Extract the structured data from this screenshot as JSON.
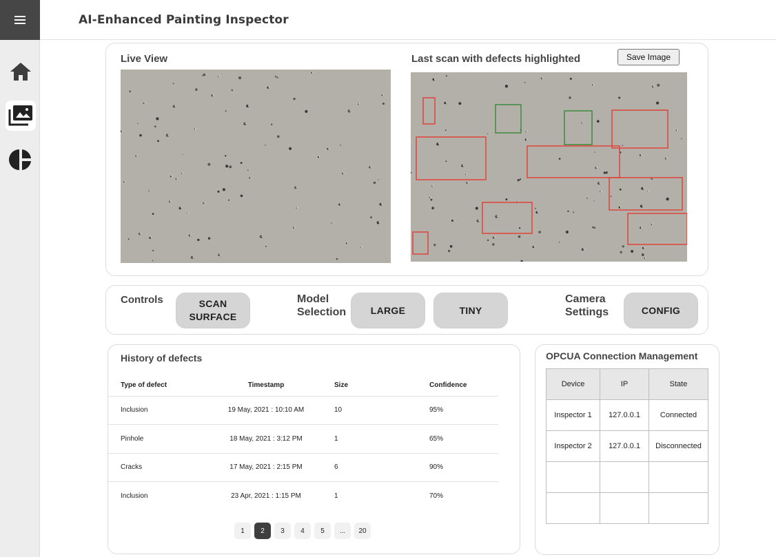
{
  "app": {
    "title": "AI-Enhanced Painting Inspector"
  },
  "sidebar": {
    "icons": [
      "menu-icon",
      "home-icon",
      "photo-library-icon",
      "pie-chart-icon"
    ],
    "active": "photo-library-icon"
  },
  "views": {
    "live_label": "Live View",
    "scan_label": "Last scan with defects highlighted",
    "save_button": "Save Image",
    "box_colors": {
      "defect": "#e0423a",
      "ok": "#3b8a3b"
    }
  },
  "controls": {
    "label": "Controls",
    "scan_button": "SCAN SURFACE",
    "model_label": "Model Selection",
    "large_button": "LARGE",
    "tiny_button": "TINY",
    "camera_label": "Camera Settings",
    "config_button": "CONFIG"
  },
  "history": {
    "title": "History of defects",
    "columns": [
      "Type of defect",
      "Timestamp",
      "Size",
      "Confidence"
    ],
    "rows": [
      {
        "type": "Inclusion",
        "timestamp": "19 May, 2021 : 10:10 AM",
        "size": "10",
        "confidence": "95%"
      },
      {
        "type": "Pinhole",
        "timestamp": "18 May, 2021 : 3:12 PM",
        "size": "1",
        "confidence": "65%"
      },
      {
        "type": "Cracks",
        "timestamp": "17 May, 2021 : 2:15 PM",
        "size": "6",
        "confidence": "90%"
      },
      {
        "type": "Inclusion",
        "timestamp": "23 Apr, 2021 : 1:15 PM",
        "size": "1",
        "confidence": "70%"
      }
    ],
    "pages": [
      "1",
      "2",
      "3",
      "4",
      "5",
      "...",
      "20"
    ],
    "current_page": "2"
  },
  "opcua": {
    "title": "OPCUA Connection Management",
    "columns": [
      "Device",
      "IP",
      "State"
    ],
    "rows": [
      {
        "device": "Inspector 1",
        "ip": "127.0.0.1",
        "state": "Connected"
      },
      {
        "device": "Inspector 2",
        "ip": "127.0.0.1",
        "state": "Disconnected"
      },
      {
        "device": "",
        "ip": "",
        "state": ""
      },
      {
        "device": "",
        "ip": "",
        "state": ""
      }
    ]
  }
}
